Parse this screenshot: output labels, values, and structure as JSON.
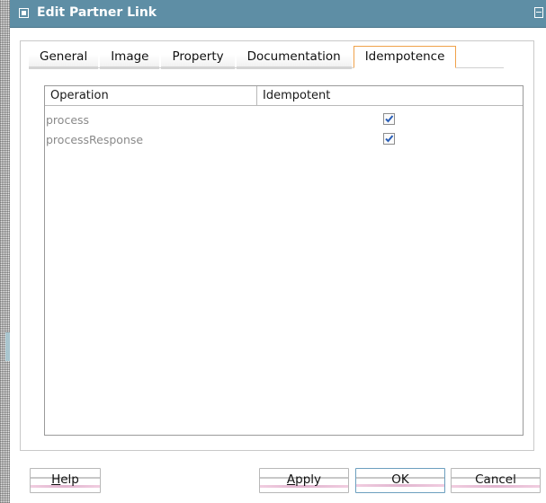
{
  "window": {
    "title": "Edit Partner Link"
  },
  "tabs": [
    {
      "label": "General"
    },
    {
      "label": "Image"
    },
    {
      "label": "Property"
    },
    {
      "label": "Documentation"
    },
    {
      "label": "Idempotence"
    }
  ],
  "active_tab": "Idempotence",
  "table": {
    "columns": [
      "Operation",
      "Idempotent"
    ],
    "rows": [
      {
        "operation": "process",
        "idempotent": true
      },
      {
        "operation": "processResponse",
        "idempotent": true
      }
    ]
  },
  "buttons": {
    "help": {
      "label": "Help",
      "mnemonic": "H"
    },
    "apply": {
      "label": "Apply",
      "mnemonic": "A"
    },
    "ok": {
      "label": "OK"
    },
    "cancel": {
      "label": "Cancel"
    }
  },
  "colors": {
    "titlebar": "#5e8ea5",
    "active_tab_border": "#f0a24a",
    "checkmark": "#2b5fb8"
  },
  "icons": [
    "window-menu-icon",
    "maximize-icon",
    "checkbox-checked-icon"
  ]
}
